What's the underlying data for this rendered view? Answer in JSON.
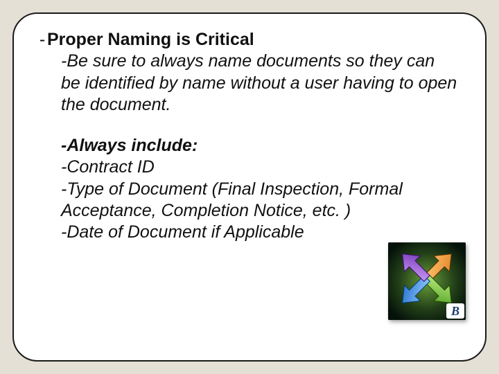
{
  "slide": {
    "heading_dash": "-",
    "heading_title": "Proper Naming is Critical",
    "body1": "-Be sure to always name documents so they can be identified by name without a user having to open the document.",
    "include_heading": "-Always include:",
    "include_items": [
      "-Contract ID",
      "-Type of Document (Final Inspection, Formal Acceptance, Completion Notice, etc. )",
      "-Date of Document if Applicable"
    ],
    "badge_letter": "B"
  }
}
